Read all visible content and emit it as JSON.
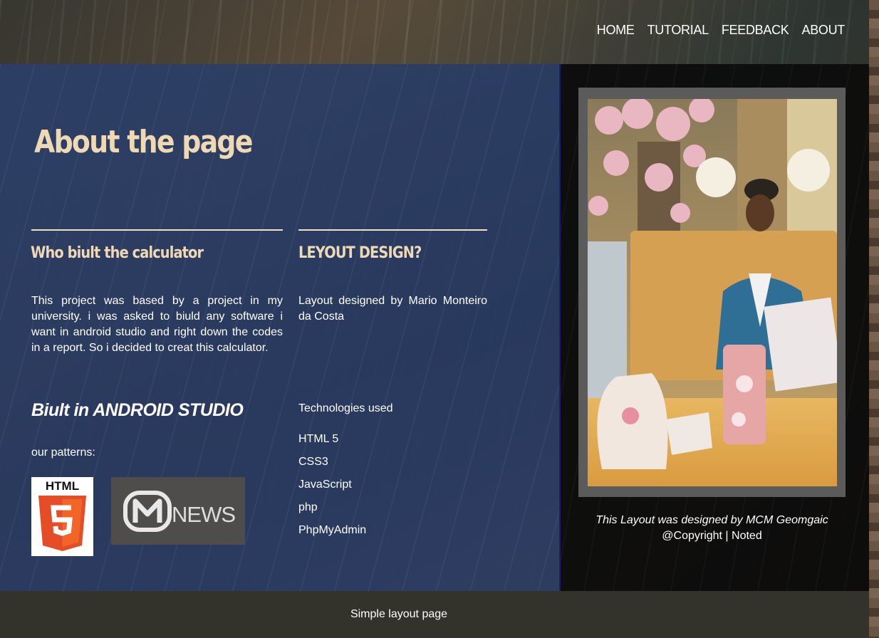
{
  "nav": {
    "items": [
      "HOME",
      "TUTORIAL",
      "FEEDBACK",
      "ABOUT"
    ]
  },
  "main": {
    "title": "About the page",
    "section1": {
      "heading": "Who biult the calculator",
      "text": "This project was based by a project in my university. i was asked to biuld any software i want in android studio and right down the codes in a report. So i decided to creat this calculator."
    },
    "section2": {
      "heading": "LEYOUT DESIGN?",
      "text": "Layout designed by Mario Monteiro da Costa"
    },
    "built": "Biult in ANDROID STUDIO",
    "patterns_label": "our patterns:",
    "patterns": [
      {
        "name": "html5-logo",
        "text": "HTML"
      },
      {
        "name": "mnews-logo",
        "text": "NEWS"
      }
    ],
    "tech_title": "Technologies used",
    "tech_list": [
      "HTML 5",
      "CSS3",
      "JavaScript",
      "php",
      "PhpMyAdmin"
    ]
  },
  "aside": {
    "caption_italic": "This Layout was designed by MCM Geomgaic",
    "caption_plain": "@Copyright | Noted"
  },
  "footer": {
    "text": "Simple layout page"
  },
  "colors": {
    "heading": "#efd9b4",
    "main_bg": "#2c406c",
    "aside_bg": "#0c0c0c",
    "footer_bg": "#33332b",
    "html5_orange": "#e44d26"
  }
}
